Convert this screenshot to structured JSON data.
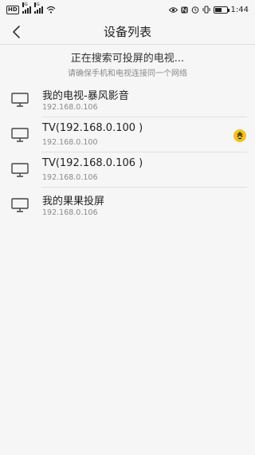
{
  "status_bar": {
    "left_badge": "HD",
    "signal1_net": "3G",
    "signal2_net": "4G",
    "time": "1:44"
  },
  "header": {
    "title": "设备列表"
  },
  "search": {
    "status_text": "正在搜索可投屏的电视...",
    "hint_text": "请确保手机和电视连接同一个网络"
  },
  "devices": [
    {
      "name": "我的电视-暴风影音",
      "ip": "192.168.0.106"
    },
    {
      "name": "TV(192.168.0.100 )",
      "ip": "192.168.0.100"
    },
    {
      "name": "TV(192.168.0.106 )",
      "ip": "192.168.0.106"
    },
    {
      "name": "我的果果投屏",
      "ip": "192.168.0.106"
    }
  ],
  "icons": {
    "back": "chevron-left-icon",
    "device": "monitor-icon",
    "floating": "yellow-badge-icon"
  },
  "colors": {
    "background": "#f6f6f6",
    "badge": "#f4c21b",
    "secondary_text": "#8a8a8a"
  }
}
